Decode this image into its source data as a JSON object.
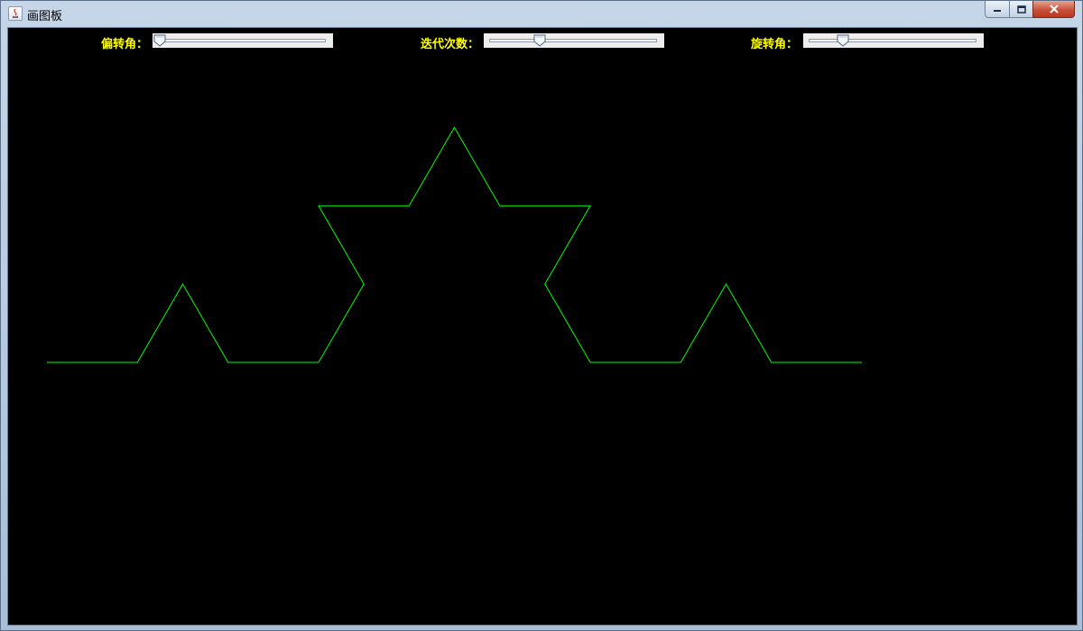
{
  "window": {
    "title": "画图板"
  },
  "controls": {
    "deflection_angle": {
      "label": "偏转角：",
      "value_fraction": 0.0
    },
    "iterations": {
      "label": "迭代次数：",
      "value_fraction": 0.3
    },
    "rotation_angle": {
      "label": "旋转角：",
      "value_fraction": 0.2
    }
  },
  "drawing": {
    "background_color": "#000000",
    "stroke_color": "#00ff00",
    "text_color": "#ffff00",
    "iterations_drawn": 2
  }
}
